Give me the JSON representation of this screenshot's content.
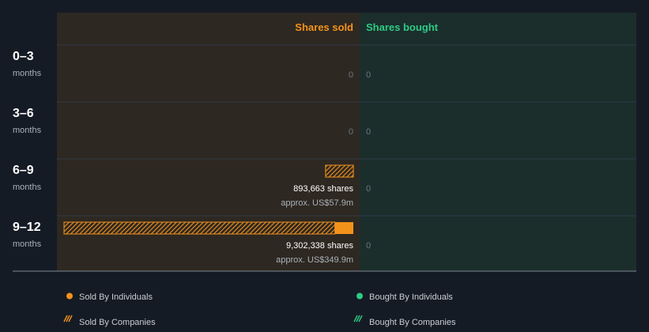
{
  "chart_data": {
    "type": "bar",
    "orientation": "horizontal",
    "headers": {
      "sold": "Shares sold",
      "bought": "Shares bought"
    },
    "rows": [
      {
        "range": "0–3",
        "unit": "months",
        "sold_individuals": 0,
        "sold_companies": 0,
        "sold_label": "0",
        "sold_value_label": "",
        "bought_label": "0"
      },
      {
        "range": "3–6",
        "unit": "months",
        "sold_individuals": 0,
        "sold_companies": 0,
        "sold_label": "0",
        "sold_value_label": "",
        "bought_label": "0"
      },
      {
        "range": "6–9",
        "unit": "months",
        "sold_individuals": 0,
        "sold_companies": 893663,
        "sold_label": "893,663 shares",
        "sold_value_label": "approx. US$57.9m",
        "bought_label": "0"
      },
      {
        "range": "9–12",
        "unit": "months",
        "sold_individuals": 593000,
        "sold_companies": 8709338,
        "sold_label": "9,302,338 shares",
        "sold_value_label": "approx. US$349.9m",
        "bought_label": "0"
      }
    ],
    "max_sold": 9302338,
    "legend": [
      {
        "key": "sold_individuals",
        "label": "Sold By Individuals",
        "color": "#f3921b",
        "pattern": "solid"
      },
      {
        "key": "bought_individuals",
        "label": "Bought By Individuals",
        "color": "#2ecb84",
        "pattern": "solid"
      },
      {
        "key": "sold_companies",
        "label": "Sold By Companies",
        "color": "#f3921b",
        "pattern": "hatched"
      },
      {
        "key": "bought_companies",
        "label": "Bought By Companies",
        "color": "#2ecb84",
        "pattern": "hatched"
      }
    ],
    "colors": {
      "sold": "#f3921b",
      "bought": "#2ecb84"
    }
  }
}
